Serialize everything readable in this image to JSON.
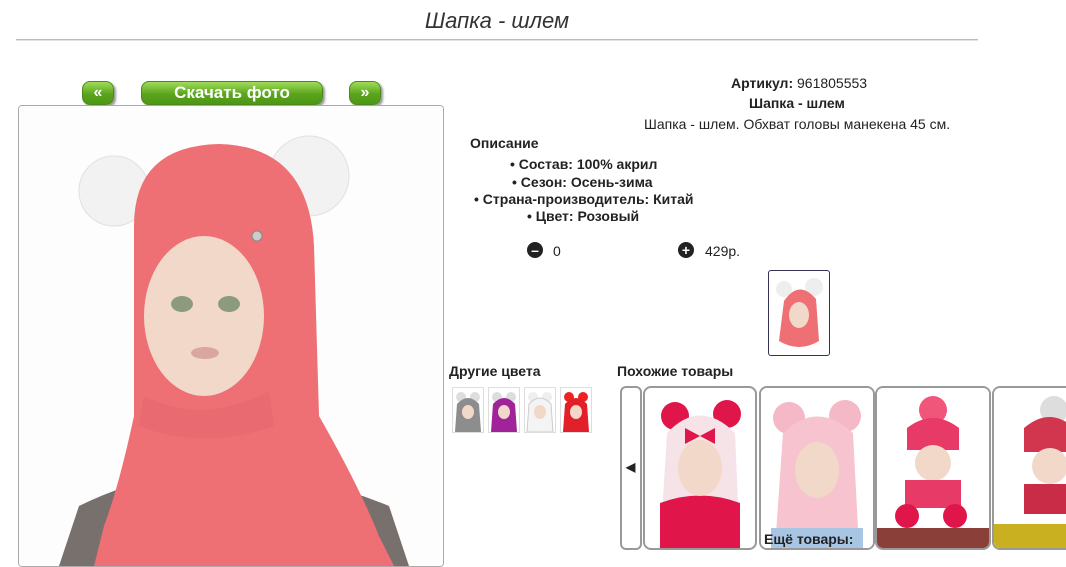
{
  "page": {
    "title": "Шапка - шлем"
  },
  "gallery": {
    "prev_label": "«",
    "download_label": "Скачать фото",
    "next_label": "»"
  },
  "product": {
    "article_label": "Артикул:",
    "article_value": "961805553",
    "name": "Шапка - шлем",
    "short_desc": "Шапка - шлем. Обхват головы манекена 45 см.",
    "description_title": "Описание",
    "bullets": [
      "Состав: 100% акрил",
      "Сезон: Осень-зима",
      "Страна-производитель: Китай",
      "Цвет: Розовый"
    ],
    "quantity": "0",
    "price": "429р."
  },
  "other_colors": {
    "title": "Другие цвета",
    "swatches": [
      "gray",
      "purple",
      "white",
      "red"
    ]
  },
  "similar": {
    "title": "Похожие товары",
    "more_label": "Ещё товары:"
  },
  "colors": {
    "accent_green": "#5aa51c",
    "hat_pink": "#ee6f74"
  }
}
